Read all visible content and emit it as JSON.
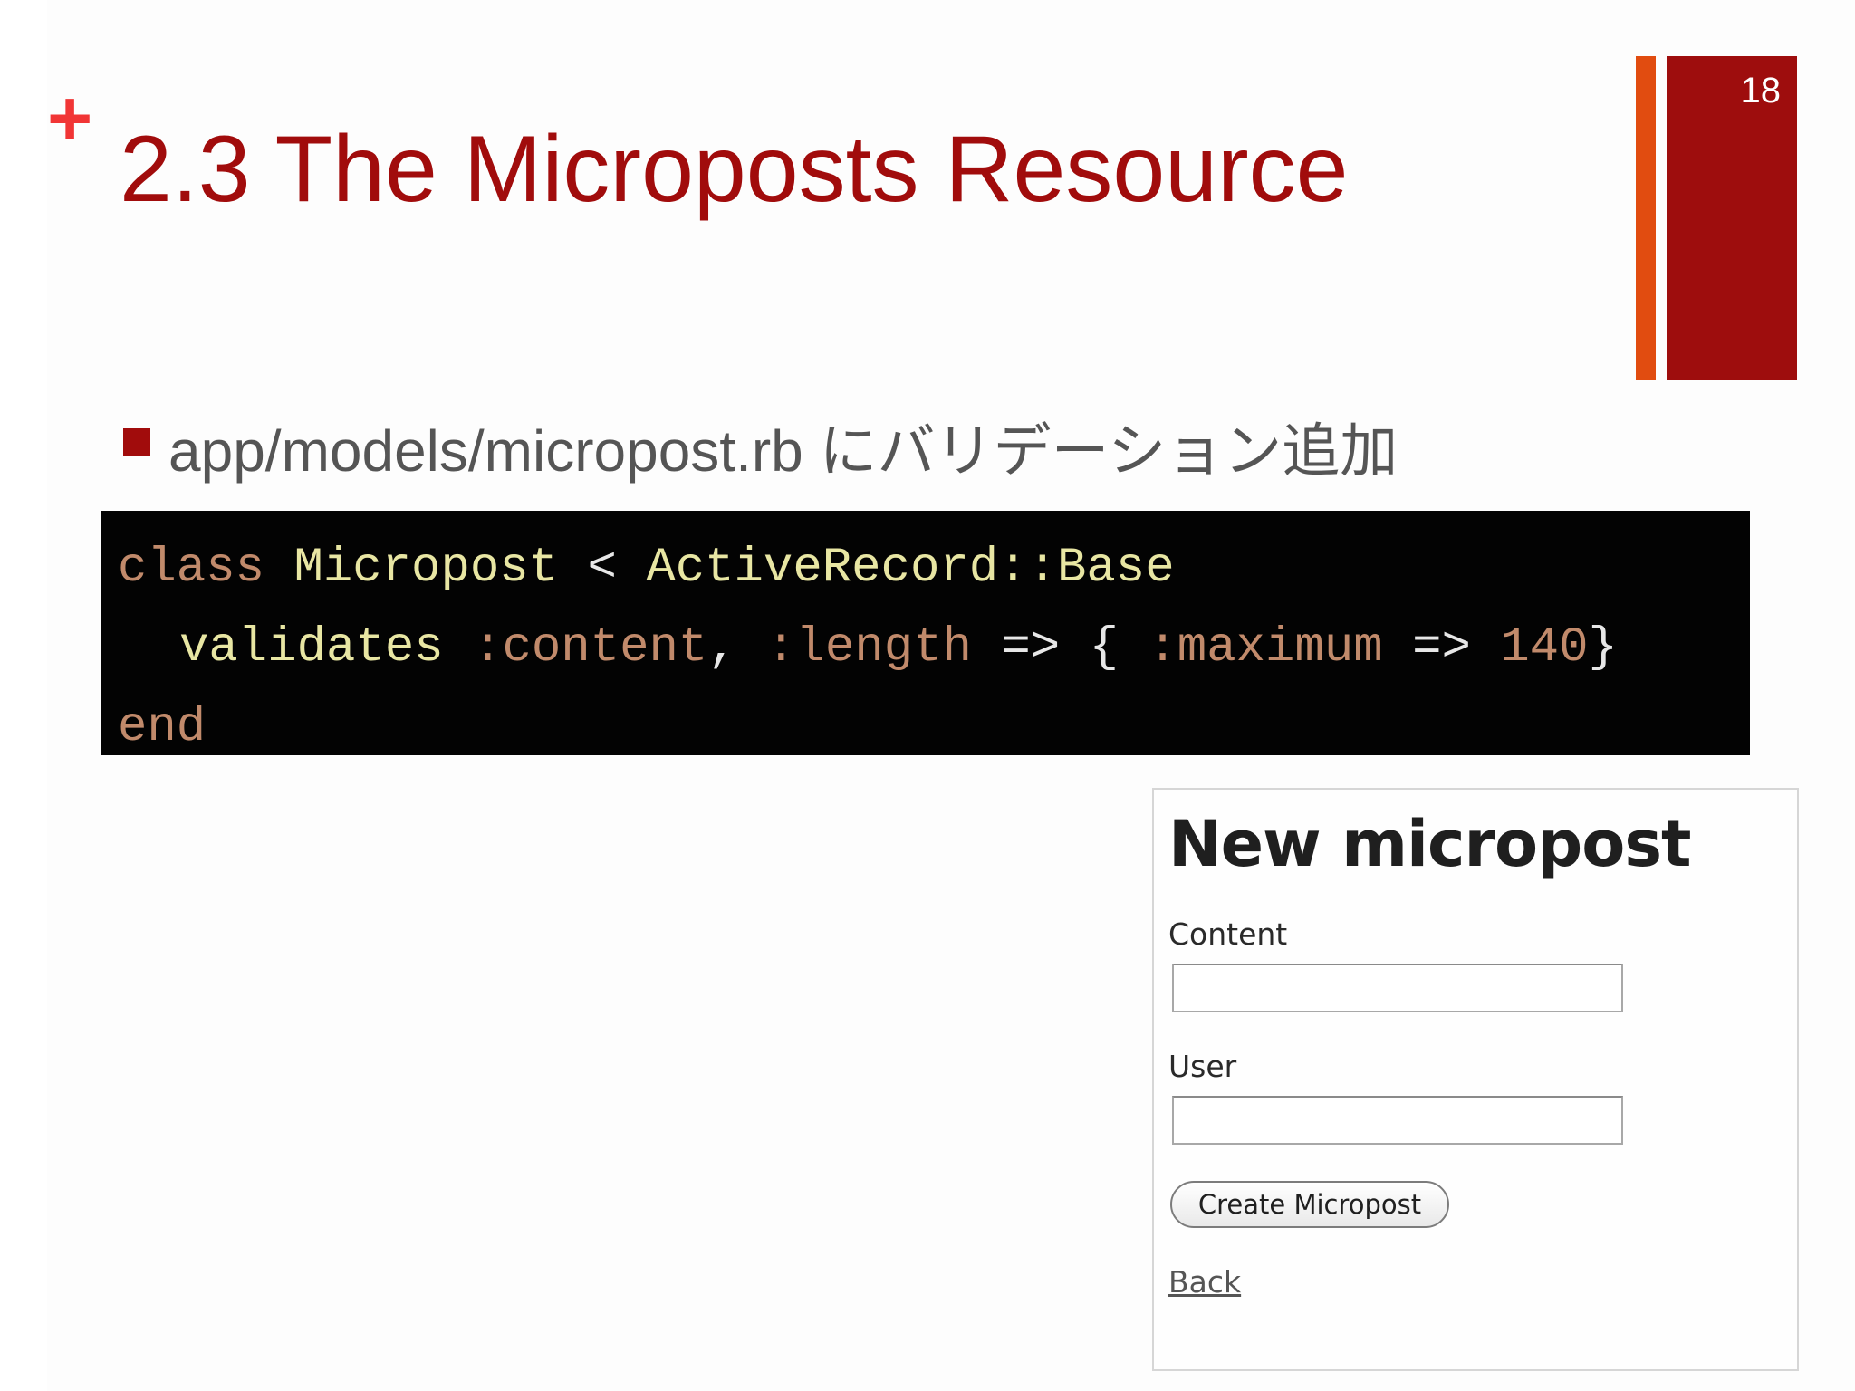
{
  "slide": {
    "plus_mark": "+",
    "title": "2.3 The Microposts Resource",
    "page_number": "18",
    "bullet": "app/models/micropost.rb にバリデーション追加"
  },
  "code": {
    "line1": {
      "keyword": "class",
      "class_name": "Micropost",
      "operator": "<",
      "parent": "ActiveRecord::Base"
    },
    "line2": {
      "method": "validates",
      "symbol1": ":content",
      "comma": ",",
      "symbol2": ":length",
      "arrow1": "=>",
      "brace_open": "{",
      "symbol3": ":maximum",
      "arrow2": "=>",
      "number": "140",
      "brace_close": "}"
    },
    "line3": {
      "keyword": "end"
    }
  },
  "form": {
    "heading": "New micropost",
    "content_label": "Content",
    "content_value": "",
    "user_label": "User",
    "user_value": "",
    "submit_label": "Create Micropost",
    "back_link": "Back"
  },
  "colors": {
    "title_red": "#a10c0c",
    "accent_orange": "#e14c10",
    "plus_red": "#f13535",
    "code_background": "#030303"
  }
}
